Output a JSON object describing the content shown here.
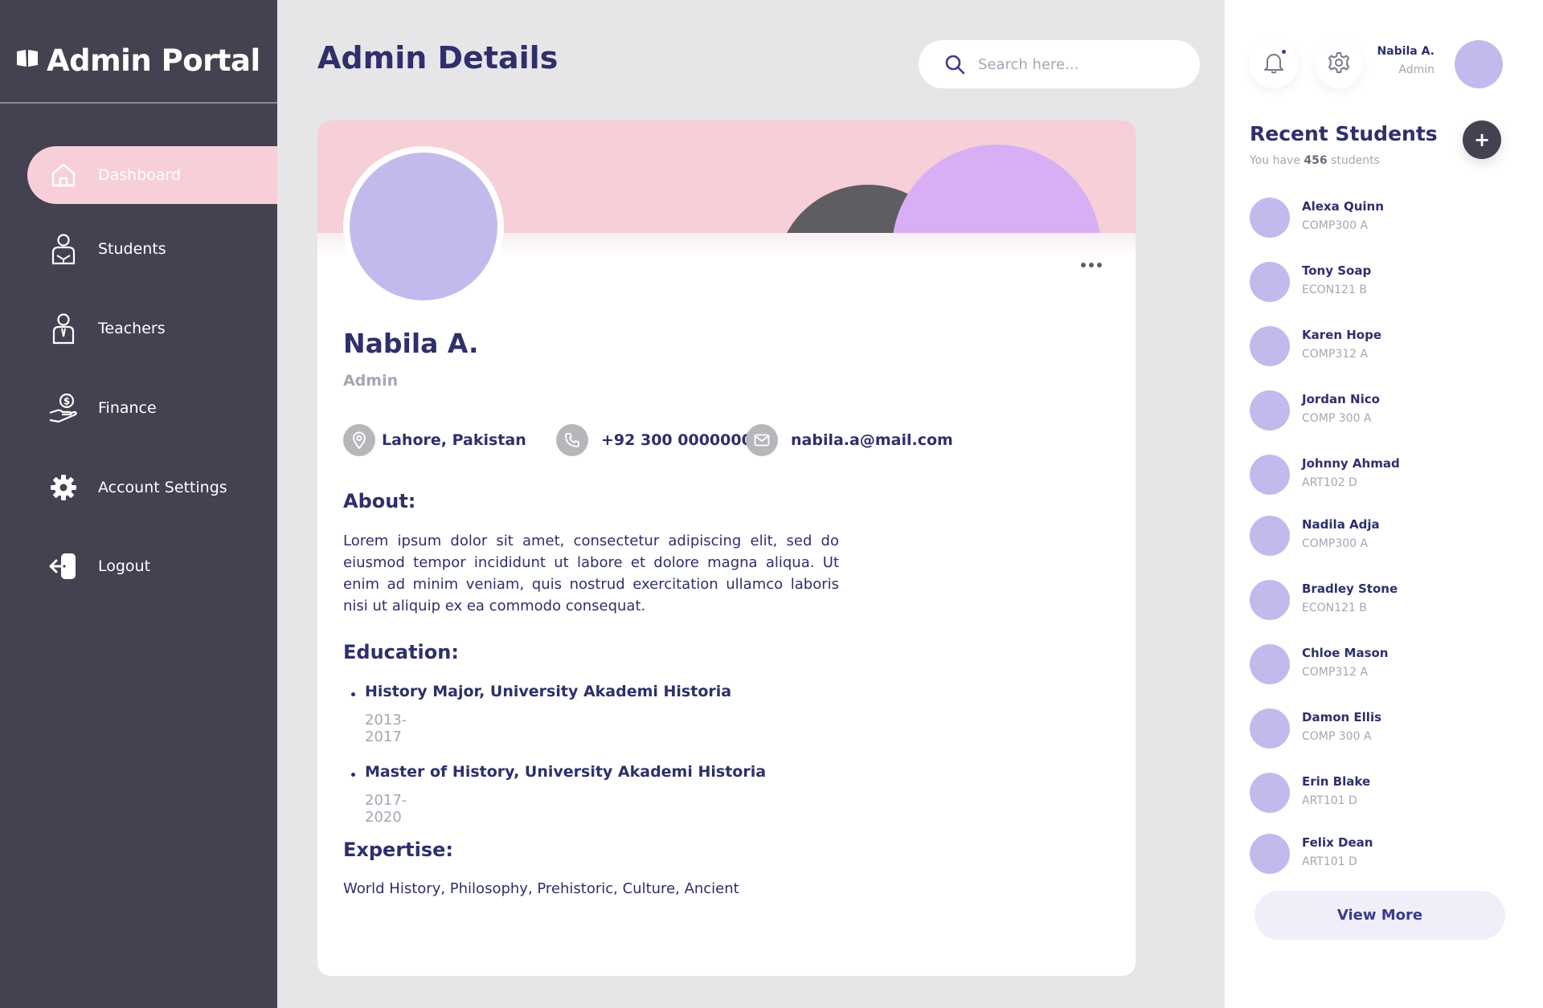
{
  "brand": {
    "title": "Admin Portal"
  },
  "nav": {
    "items": [
      {
        "label": "Dashboard",
        "icon": "home-icon"
      },
      {
        "label": "Students",
        "icon": "student-icon"
      },
      {
        "label": "Teachers",
        "icon": "teacher-icon"
      },
      {
        "label": "Finance",
        "icon": "finance-icon"
      },
      {
        "label": "Account Settings",
        "icon": "gear-icon"
      },
      {
        "label": "Logout",
        "icon": "logout-icon"
      }
    ],
    "active": "Dashboard"
  },
  "header": {
    "title": "Admin Details",
    "search_placeholder": "Search here..."
  },
  "profile": {
    "name": "Nabila A.",
    "role": "Admin",
    "location": "Lahore, Pakistan",
    "phone": "+92 300 0000000",
    "email": "nabila.a@mail.com",
    "about_title": "About:",
    "about_text": "Lorem ipsum dolor sit amet, consectetur adipiscing elit, sed do eiusmod tempor incididunt ut labore et dolore magna aliqua. Ut enim ad minim veniam, quis nostrud exercitation ullamco laboris nisi ut aliquip ex ea commodo consequat.",
    "education_title": "Education:",
    "education": [
      {
        "title": "History Major, University Akademi Historia",
        "years": "2013-2017"
      },
      {
        "title": "Master of History, University Akademi Historia",
        "years": "2017-2020"
      }
    ],
    "expertise_title": "Expertise:",
    "expertise_text": "World History, Philosophy, Prehistoric, Culture, Ancient"
  },
  "user": {
    "name": "Nabila A.",
    "role": "Admin"
  },
  "recent_students": {
    "title": "Recent Students",
    "subtitle_prefix": "You have",
    "count": "456",
    "subtitle_suffix": "students",
    "add_label": "+",
    "students": [
      {
        "name": "Alexa Quinn",
        "class": "COMP300 A"
      },
      {
        "name": "Tony Soap",
        "class": "ECON121 B"
      },
      {
        "name": "Karen Hope",
        "class": "COMP312 A"
      },
      {
        "name": "Jordan Nico",
        "class": "COMP 300 A"
      },
      {
        "name": "Johnny Ahmad",
        "class": "ART102 D"
      },
      {
        "name": "Nadila Adja",
        "class": "COMP300 A"
      },
      {
        "name": "Bradley Stone",
        "class": "ECON121 B"
      },
      {
        "name": "Chloe Mason",
        "class": "COMP312 A"
      },
      {
        "name": "Damon Ellis",
        "class": "COMP 300 A"
      },
      {
        "name": "Erin Blake",
        "class": "ART101 D"
      },
      {
        "name": "Felix Dean",
        "class": "ART101 D"
      }
    ],
    "view_more_label": "View More"
  },
  "colors": {
    "sidebar": "#444150",
    "accent_navy": "#2e2f6c",
    "active_pink": "#f6cfd8",
    "avatar_lilac": "#c2baec",
    "banner_circle_lilac": "#d8aef5",
    "banner_circle_dark": "#5e5d61"
  }
}
